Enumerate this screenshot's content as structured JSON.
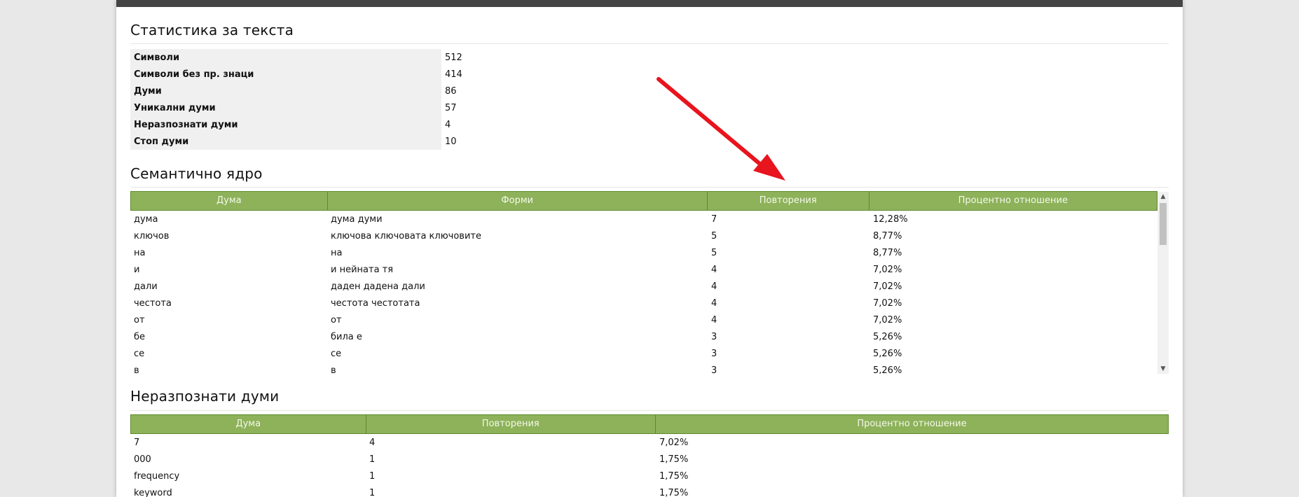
{
  "stats": {
    "title": "Статистика за текста",
    "rows": [
      {
        "label": "Символи",
        "value": "512"
      },
      {
        "label": "Символи без пр. знаци",
        "value": "414"
      },
      {
        "label": "Думи",
        "value": "86"
      },
      {
        "label": "Уникални думи",
        "value": "57"
      },
      {
        "label": "Неразпознати думи",
        "value": "4"
      },
      {
        "label": "Стоп думи",
        "value": "10"
      }
    ]
  },
  "core": {
    "title": "Семантично ядро",
    "headers": [
      "Дума",
      "Форми",
      "Повторения",
      "Процентно отношение"
    ],
    "rows": [
      [
        "дума",
        "дума думи",
        "7",
        "12,28%"
      ],
      [
        "ключов",
        "ключова ключовата ключовите",
        "5",
        "8,77%"
      ],
      [
        "на",
        "на",
        "5",
        "8,77%"
      ],
      [
        "и",
        "и нейната тя",
        "4",
        "7,02%"
      ],
      [
        "дали",
        "даден дадена дали",
        "4",
        "7,02%"
      ],
      [
        "честота",
        "честота честотата",
        "4",
        "7,02%"
      ],
      [
        "от",
        "от",
        "4",
        "7,02%"
      ],
      [
        "бе",
        "била е",
        "3",
        "5,26%"
      ],
      [
        "се",
        "се",
        "3",
        "5,26%"
      ],
      [
        "в",
        "в",
        "3",
        "5,26%"
      ]
    ]
  },
  "unknown": {
    "title": "Неразпознати думи",
    "headers": [
      "Дума",
      "Повторения",
      "Процентно отношение"
    ],
    "rows": [
      [
        "7",
        "4",
        "7,02%"
      ],
      [
        "000",
        "1",
        "1,75%"
      ],
      [
        "frequency",
        "1",
        "1,75%"
      ],
      [
        "keyword",
        "1",
        "1,75%"
      ]
    ]
  },
  "colors": {
    "header_green": "#8db25a",
    "arrow_red": "#e8141e"
  }
}
